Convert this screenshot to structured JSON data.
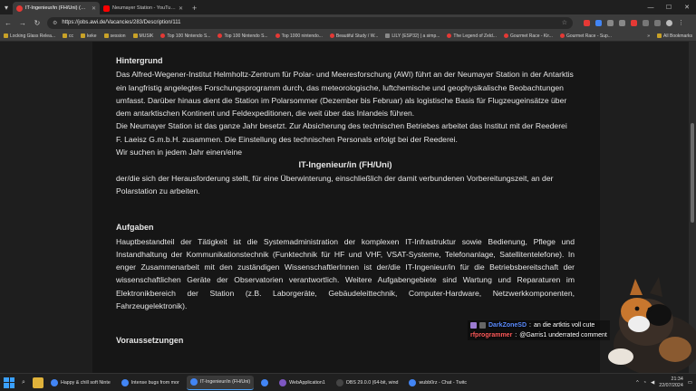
{
  "browser": {
    "tabs": [
      {
        "title": "IT-Ingenieur/in (FH/Uni) (Über...",
        "favicon_color": "#e53935",
        "active": true
      },
      {
        "title": "Neumayer Station - YouTube",
        "favicon_color": "#ff0000",
        "active": false
      }
    ],
    "url": "https://jobs.awi.de/Vacancies/283/Description/111",
    "bookmarks": [
      {
        "label": "Locking Glass Relea...",
        "kind": "folder"
      },
      {
        "label": "cc",
        "kind": "folder"
      },
      {
        "label": "keke",
        "kind": "folder"
      },
      {
        "label": "session",
        "kind": "folder"
      },
      {
        "label": "MUSIK",
        "kind": "folder"
      },
      {
        "label": "Top 100 Nintendo S...",
        "kind": "yt"
      },
      {
        "label": "Top 100 Nintendo S...",
        "kind": "yt"
      },
      {
        "label": "Top 1000 nintendo...",
        "kind": "yt"
      },
      {
        "label": "Beautiful Study / W...",
        "kind": "yt"
      },
      {
        "label": "LILY (ESP32) | a simp...",
        "kind": "page"
      },
      {
        "label": "The Legend of Zeld...",
        "kind": "yt"
      },
      {
        "label": "Gourmet Race - Kir...",
        "kind": "yt"
      },
      {
        "label": "Gourmet Race - Sup...",
        "kind": "yt"
      }
    ],
    "all_bookmarks": "All Bookmarks"
  },
  "page": {
    "section1_heading": "Hintergrund",
    "section1_p1": "Das Alfred-Wegener-Institut Helmholtz-Zentrum für Polar- und Meeresforschung (AWI) führt an der Neumayer Station in der Antarktis ein langfristig angelegtes Forschungsprogramm durch, das meteorologische, luftchemische und geophysikalische Beobachtungen umfasst. Darüber hinaus dient die Station im Polarsommer (Dezember bis Februar) als logistische Basis für Flugzeugeinsätze über dem antarktischen Kontinent und Feldexpeditionen, die weit über das Inlandeis führen.",
    "section1_p2": "Die Neumayer Station ist das ganze Jahr besetzt. Zur Absicherung des technischen Betriebes arbeitet das Institut mit der Reederei F. Laeisz G.m.b.H. zusammen. Die Einstellung des technischen Personals erfolgt bei der Reederei.",
    "section1_p3": "Wir suchen in jedem Jahr einen/eine",
    "job_title": "IT-Ingenieur/in (FH/Uni)",
    "job_subtitle": "der/die sich der Herausforderung stellt, für eine Überwinterung, einschließlich der damit verbundenen Vorbereitungszeit, an der Polarstation zu arbeiten.",
    "section2_heading": "Aufgaben",
    "section2_p1": "Hauptbestandteil der Tätigkeit ist die Systemadministration der komplexen IT-Infrastruktur sowie Bedienung, Pflege und Instandhaltung der Kommunikationstechnik (Funktechnik für HF und VHF, VSAT-Systeme, Telefonanlage, Satellitentelefone). In enger Zusammenarbeit mit den zuständigen WissenschaftlerInnen ist der/die IT-Ingenieur/in für die Betriebsbereitschaft der wissenschaftlichen Geräte der Observatorien verantwortlich. Weitere Aufgabengebiete sind Wartung und Reparaturen im Elektronikbereich der Station (z.B. Laborgeräte, Gebäudeleittechnik, Computer-Hardware, Netzwerkkomponenten, Fahrzeugelektronik).",
    "section3_heading": "Voraussetzungen"
  },
  "chat": [
    {
      "user": "DarkZoneSD",
      "text": "an die artktis voll cute",
      "color": "#5b8cff"
    },
    {
      "user": "rfprogrammer",
      "text": "@Garris1 underrated comment",
      "color": "#ff5a5a"
    }
  ],
  "taskbar": {
    "apps": [
      {
        "label": "Happy & chill soft Ninte",
        "color": "#4285f4",
        "active": false
      },
      {
        "label": "Intense bugs from mor",
        "color": "#4285f4",
        "active": false
      },
      {
        "label": "IT-Ingenieur/in (FH/Uni)",
        "color": "#4285f4",
        "active": true
      },
      {
        "label": "",
        "color": "#4285f4",
        "active": false
      },
      {
        "label": "WebApplication1",
        "color": "#7e57c2",
        "active": false
      },
      {
        "label": "OBS 29.0.0 (64-bit, wind",
        "color": "#444",
        "active": false
      },
      {
        "label": "wubb0rz - Chat - Twitc",
        "color": "#4285f4",
        "active": false
      }
    ],
    "time": "21:34",
    "date": "22/07/2024"
  }
}
